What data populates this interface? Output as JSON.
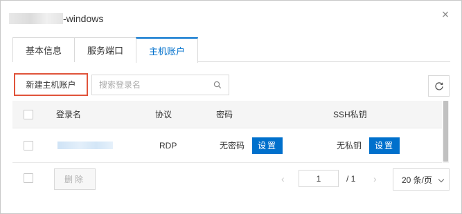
{
  "dialog": {
    "title_suffix": "-windows",
    "close_symbol": "×"
  },
  "tabs": [
    {
      "label": "基本信息"
    },
    {
      "label": "服务端口"
    },
    {
      "label": "主机账户"
    }
  ],
  "toolbar": {
    "new_button": "新建主机账户",
    "search_placeholder": "搜索登录名"
  },
  "table": {
    "columns": [
      "登录名",
      "协议",
      "密码",
      "SSH私钥"
    ],
    "rows": [
      {
        "protocol": "RDP",
        "password_status": "无密码",
        "password_action": "设置",
        "key_status": "无私钥",
        "key_action": "设置"
      }
    ]
  },
  "footer": {
    "delete_button": "删除",
    "prev_symbol": "‹",
    "current_page": "1",
    "total": "/ 1",
    "next_symbol": "›",
    "page_size": "20 条/页"
  },
  "icons": {
    "close": "close-icon",
    "search": "search-icon",
    "refresh": "refresh-icon",
    "dropdown": "chevron-down-icon"
  },
  "colors": {
    "accent": "#0070cc",
    "highlight_border": "#e0533a"
  }
}
